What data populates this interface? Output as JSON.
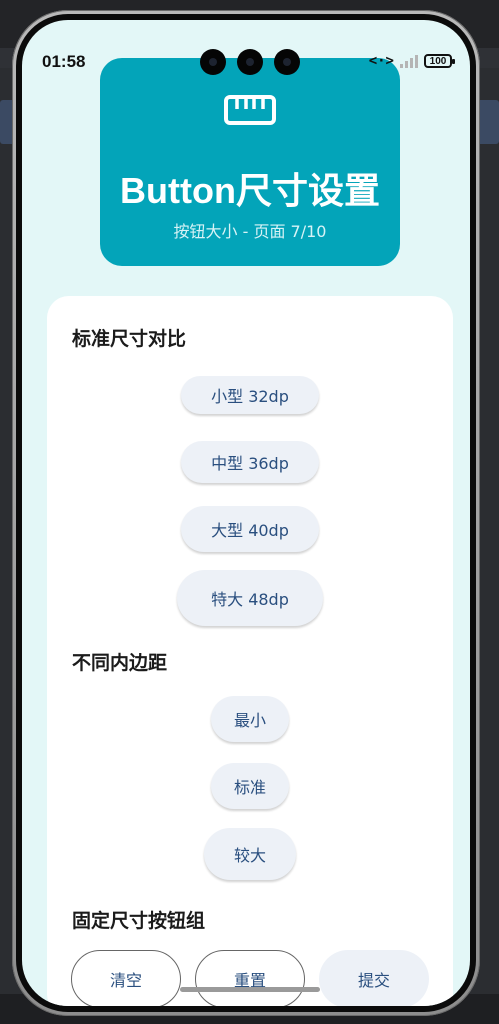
{
  "status_bar": {
    "time": "01:58",
    "battery": "100"
  },
  "header": {
    "icon": "ruler-icon",
    "title": "Button尺寸设置",
    "subtitle": "按钮大小 - 页面 7/10"
  },
  "sections": {
    "standard": {
      "title": "标准尺寸对比",
      "buttons": [
        "小型 32dp",
        "中型 36dp",
        "大型 40dp",
        "特大 48dp"
      ]
    },
    "padding": {
      "title": "不同内边距",
      "buttons": [
        "最小",
        "标准",
        "较大"
      ]
    },
    "fixed": {
      "title": "固定尺寸按钮组",
      "buttons": [
        "清空",
        "重置",
        "提交"
      ]
    }
  },
  "colors": {
    "header_bg": "#03a4b9",
    "screen_bg": "#e3f7f7",
    "button_bg": "#edf1f7",
    "button_text": "#2a4f7f"
  }
}
